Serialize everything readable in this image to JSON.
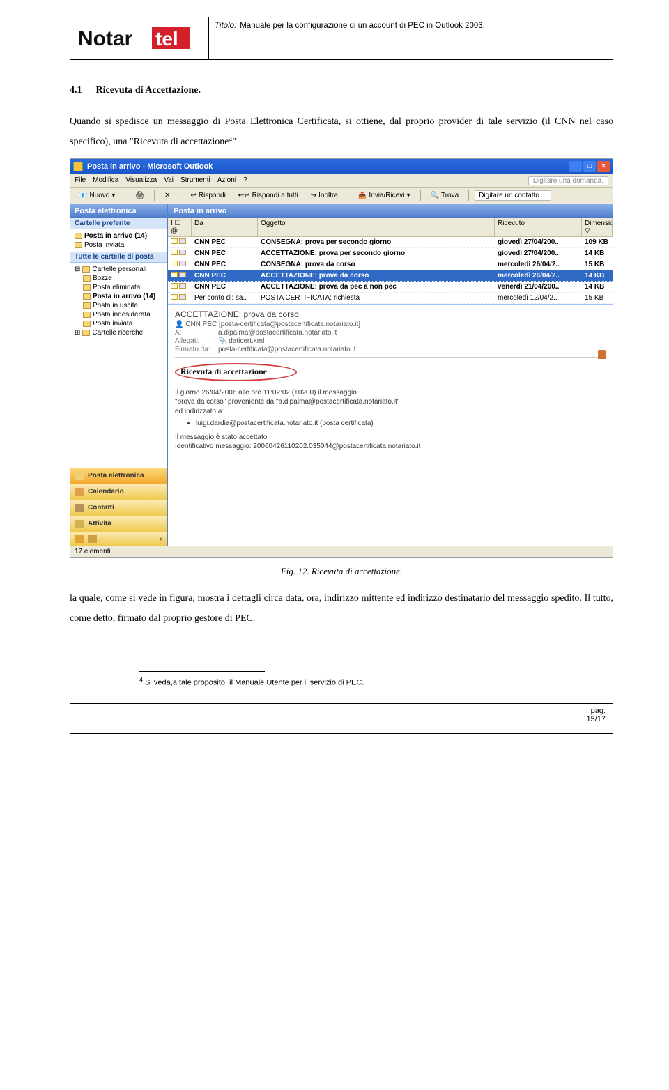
{
  "header": {
    "title_label": "Titolo:",
    "title": "Manuale per la configurazione di un account di PEC in Outlook 2003.",
    "logo_text_left": "Notar",
    "logo_text_right": "tel"
  },
  "section": {
    "number": "4.1",
    "title": "Ricevuta di Accettazione."
  },
  "para1": "Quando si spedisce un messaggio di Posta Elettronica Certificata, si ottiene, dal proprio provider di tale servizio (il CNN nel caso specifico), una \"Ricevuta di accettazione⁴\"",
  "screenshot": {
    "window_title": "Posta in arrivo - Microsoft Outlook",
    "menu": [
      "File",
      "Modifica",
      "Visualizza",
      "Vai",
      "Strumenti",
      "Azioni",
      "?"
    ],
    "help_placeholder": "Digitare una domanda.",
    "toolbar": {
      "new": "Nuovo",
      "reply": "Rispondi",
      "reply_all": "Rispondi a tutti",
      "forward": "Inoltra",
      "sendrecv": "Invia/Ricevi",
      "find": "Trova",
      "contact_ph": "Digitare un contatto"
    },
    "nav": {
      "header": "Posta elettronica",
      "fav_label": "Cartelle preferite",
      "fav_items": [
        {
          "label": "Posta in arrivo (14)",
          "bold": true
        },
        {
          "label": "Posta inviata",
          "bold": false
        }
      ],
      "all_label": "Tutte le cartelle di posta",
      "all_items": [
        {
          "label": "Cartelle personali",
          "bold": false
        },
        {
          "label": "Bozze",
          "bold": false
        },
        {
          "label": "Posta eliminata",
          "bold": false
        },
        {
          "label": "Posta in arrivo (14)",
          "bold": true
        },
        {
          "label": "Posta in uscita",
          "bold": false
        },
        {
          "label": "Posta indesiderata",
          "bold": false
        },
        {
          "label": "Posta inviata",
          "bold": false
        },
        {
          "label": "Cartelle ricerche",
          "bold": false
        }
      ],
      "buttons": [
        "Posta elettronica",
        "Calendario",
        "Contatti",
        "Attività"
      ]
    },
    "grid": {
      "header": "Posta in arrivo",
      "cols": {
        "icons": "! ☐ @ Da",
        "from": "Da",
        "subject": "Oggetto",
        "date": "Ricevuto",
        "size": "Dimensione ▽"
      },
      "rows": [
        {
          "from": "CNN PEC",
          "subject": "CONSEGNA: prova per secondo giorno",
          "date": "giovedì 27/04/200..",
          "size": "109 KB",
          "sel": false,
          "bold": true
        },
        {
          "from": "CNN PEC",
          "subject": "ACCETTAZIONE: prova per secondo giorno",
          "date": "giovedì 27/04/200..",
          "size": "14 KB",
          "sel": false,
          "bold": true
        },
        {
          "from": "CNN PEC",
          "subject": "CONSEGNA: prova da corso",
          "date": "mercoledì 26/04/2..",
          "size": "15 KB",
          "sel": false,
          "bold": true
        },
        {
          "from": "CNN PEC",
          "subject": "ACCETTAZIONE: prova da corso",
          "date": "mercoledì 26/04/2..",
          "size": "14 KB",
          "sel": true,
          "bold": true
        },
        {
          "from": "CNN PEC",
          "subject": "ACCETTAZIONE: prova da pec a non pec",
          "date": "venerdì 21/04/200..",
          "size": "14 KB",
          "sel": false,
          "bold": true
        },
        {
          "from": "Per conto di: sa..",
          "subject": "POSTA CERTIFICATA: richiesta",
          "date": "mercoledì 12/04/2..",
          "size": "15 KB",
          "sel": false,
          "bold": false
        }
      ]
    },
    "reading": {
      "subject": "ACCETTAZIONE: prova da corso",
      "from_line": "CNN PEC [posta-certificata@postacertificata.notariato.it]",
      "to_label": "A:",
      "to": "a.dipalma@postacertificata.notariato.it",
      "attach_label": "Allegati:",
      "attach": "daticert.xml",
      "signed_label": "Firmato da:",
      "signed": "posta-certificata@postacertificata.notariato.it",
      "accept_box": "Ricevuta di accettazione",
      "body1": "Il giorno 26/04/2006 alle ore 11:02:02 (+0200) il messaggio",
      "body2": "\"prova da corso\" proveniente da \"a.dipalma@postacertificata.notariato.it\"",
      "body3": "ed indirizzato a:",
      "bullet": "luigi.dardia@postacertificata.notariato.it (posta certificata)",
      "body4": "Il messaggio è stato accettato",
      "body5": "Identificativo messaggio: 20060426110202.035044@postacertificata.notariato.it"
    },
    "status": "17 elementi"
  },
  "caption": "Fig. 12. Ricevuta di accettazione.",
  "para2": "la quale, come si vede in figura, mostra i dettagli circa data, ora, indirizzo mittente ed indirizzo destinatario del messaggio spedito. Il tutto, come detto, firmato dal proprio gestore di PEC.",
  "footnote": {
    "marker": "4",
    "text": "Si veda,a tale proposito, il Manuale Utente per il servizio di PEC."
  },
  "footer": {
    "pag_label": "pag.",
    "pag": "15/17"
  }
}
